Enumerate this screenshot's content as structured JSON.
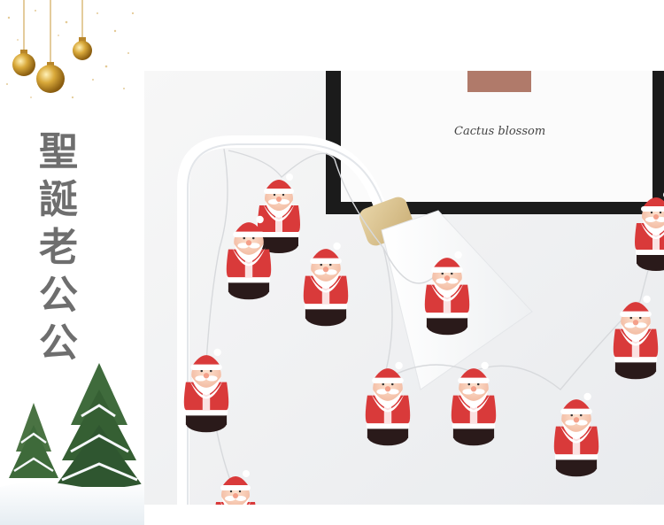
{
  "title_chars": [
    "聖",
    "誕",
    "老",
    "公",
    "公"
  ],
  "poster_text": "Cactus blossom",
  "colors": {
    "title": "#6e6e6e",
    "gold": "#d4a23a",
    "santa_red": "#d93a3a",
    "wall": "#f1f1f1"
  }
}
